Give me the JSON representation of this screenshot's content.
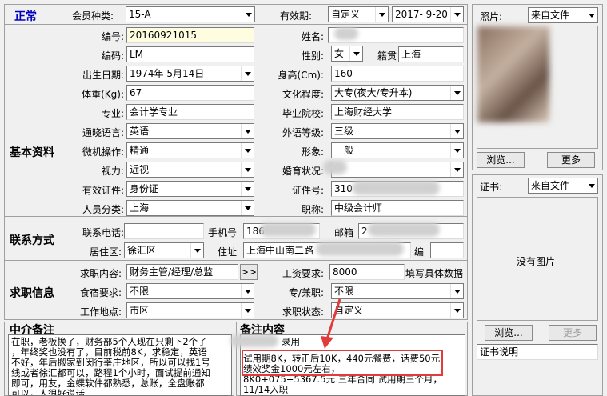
{
  "status": {
    "normal": "正常"
  },
  "sections": {
    "basic": "基本资料",
    "contact": "联系方式",
    "job": "求职信息",
    "agent_notes": "中介备注",
    "notes": "备注内容"
  },
  "row1": {
    "member_type_label": "会员种类:",
    "member_type_value": "15-A",
    "validity_label": "有效期:",
    "validity_mode": "自定义",
    "validity_date": "2017- 9-20"
  },
  "basic": {
    "id_label": "编号:",
    "id_value": "20160921015",
    "name_label": "姓名:",
    "code_label": "编码:",
    "code_value": "LM",
    "gender_label": "性别:",
    "gender_value": "女",
    "native_label": "籍贯",
    "native_value": "上海",
    "birth_label": "出生日期:",
    "birth_value": "1974年 5月14日",
    "height_label": "身高(Cm):",
    "height_value": "160",
    "weight_label": "体重(Kg):",
    "weight_value": "67",
    "edu_label": "文化程度:",
    "edu_value": "大专(夜大/专升本)",
    "major_label": "专业:",
    "major_value": "会计学专业",
    "school_label": "毕业院校:",
    "school_value": "上海财经大学",
    "lang_label": "通晓语言:",
    "lang_value": "英语",
    "foreign_label": "外语等级:",
    "foreign_value": "三级",
    "pc_label": "微机操作:",
    "pc_value": "精通",
    "image_label": "形象:",
    "image_value": "一般",
    "vision_label": "视力:",
    "vision_value": "近视",
    "marital_label": "婚育状况:",
    "valid_id_label": "有效证件:",
    "valid_id_value": "身份证",
    "idno_label": "证件号:",
    "idno_value": "310",
    "category_label": "人员分类:",
    "category_value": "上海",
    "title_label": "职称:",
    "title_value": "中级会计师"
  },
  "contact": {
    "phone_label": "联系电话:",
    "mobile_label": "手机号",
    "mobile_value": "186",
    "email_label": "邮箱",
    "email_value": "2",
    "district_label": "居住区:",
    "district_value": "徐汇区",
    "address_label": "住址",
    "address_value": "上海中山南二路",
    "postcode_label": "编"
  },
  "job": {
    "content_label": "求职内容:",
    "content_value": "财务主管/经理/总监",
    "more_btn": ">>",
    "salary_label": "工资要求:",
    "salary_value": "8000",
    "salary_hint": "填写具体数据",
    "meal_label": "食宿要求:",
    "meal_value": "不限",
    "type_label": "专/兼职:",
    "type_value": "不限",
    "place_label": "工作地点:",
    "place_value": "市区",
    "status_label": "求职状态:",
    "status_value": "自定义"
  },
  "agent_notes_lines": [
    "在职，老板换了，财务部5个人现在只剩下2个了",
    "，年终奖也没有了，目前税前8K，求稳定，英语",
    "不好，年后搬家到闵行莘庄地区，所以可以找1号",
    "线或者徐汇都可以，路程1个小时，面试提前通知",
    "即可，用友，金蝶软件都熟悉，总账，全盘账都",
    "可以，人很好说话"
  ],
  "notes_lines": [
    "录用",
    "",
    "试用期8K，转正后10K，440元餐费，话费50元；",
    "绩效奖金1000元左右，",
    "8K0+075+5367.5元    三年合同    试用期三个月，",
    "11/14入职"
  ],
  "photo": {
    "label": "照片:",
    "source": "来自文件",
    "browse": "浏览...",
    "more": "更多"
  },
  "cert": {
    "label": "证书:",
    "source": "来自文件",
    "empty": "没有图片",
    "browse": "浏览...",
    "more": "更多",
    "desc": "证书说明"
  },
  "colors": {
    "status_blue": "#0000c0",
    "highlight_red": "#e23b3b"
  }
}
